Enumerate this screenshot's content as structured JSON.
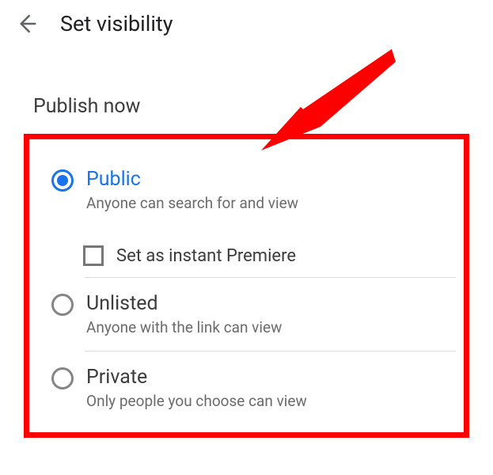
{
  "header": {
    "title": "Set visibility"
  },
  "section": {
    "label": "Publish now"
  },
  "options": [
    {
      "title": "Public",
      "description": "Anyone can search for and view",
      "selected": true,
      "sub_option_label": "Set as instant Premiere"
    },
    {
      "title": "Unlisted",
      "description": "Anyone with the link can view",
      "selected": false
    },
    {
      "title": "Private",
      "description": "Only people you choose can view",
      "selected": false
    }
  ],
  "annotation": {
    "type": "arrow",
    "color": "#ff0000"
  }
}
